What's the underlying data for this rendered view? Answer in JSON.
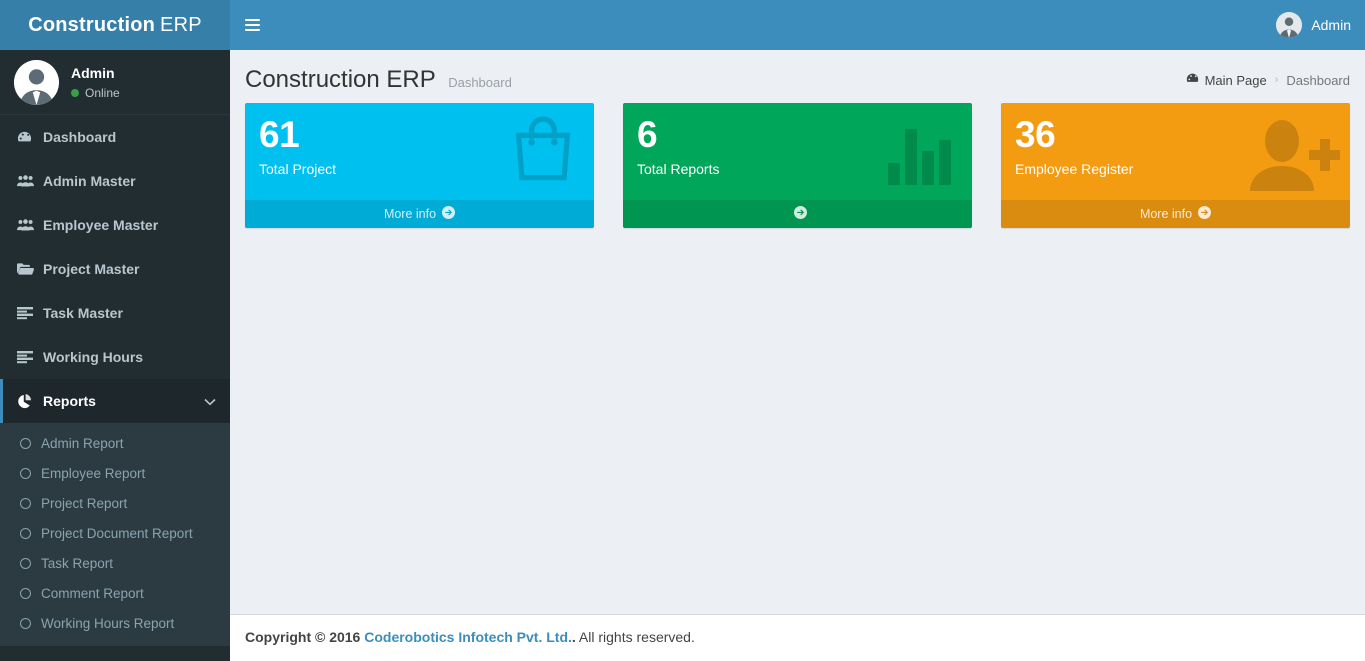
{
  "header": {
    "logo_bold": "Construction",
    "logo_light": "ERP",
    "toggle_icon": "hamburger-icon",
    "user_name": "Admin",
    "avatar_icon": "user-avatar-icon",
    "bg_color": "#3c8dbc",
    "logo_bg_color": "#367fa9"
  },
  "sidebar": {
    "bg_color": "#222d32",
    "user_panel": {
      "name": "Admin",
      "status": "Online",
      "status_color": "#3c9d46",
      "avatar_icon": "user-avatar-icon"
    },
    "items": [
      {
        "label": "Dashboard",
        "icon": "dashboard-icon",
        "active": false
      },
      {
        "label": "Admin Master",
        "icon": "users-icon",
        "active": false
      },
      {
        "label": "Employee Master",
        "icon": "users-icon",
        "active": false
      },
      {
        "label": "Project Master",
        "icon": "folder-open-icon",
        "active": false
      },
      {
        "label": "Task Master",
        "icon": "list-icon",
        "active": false
      },
      {
        "label": "Working Hours",
        "icon": "list-icon",
        "active": false
      },
      {
        "label": "Reports",
        "icon": "pie-chart-icon",
        "active": true,
        "chevron": "chevron-down-icon"
      }
    ],
    "submenu": {
      "bg_color": "#2c3b41",
      "items": [
        {
          "label": "Admin Report",
          "icon": "circle-o-icon"
        },
        {
          "label": "Employee Report",
          "icon": "circle-o-icon"
        },
        {
          "label": "Project Report",
          "icon": "circle-o-icon"
        },
        {
          "label": "Project Document Report",
          "icon": "circle-o-icon"
        },
        {
          "label": "Task Report",
          "icon": "circle-o-icon"
        },
        {
          "label": "Comment Report",
          "icon": "circle-o-icon"
        },
        {
          "label": "Working Hours Report",
          "icon": "circle-o-icon"
        }
      ]
    }
  },
  "content": {
    "title": "Construction ERP",
    "subtitle": "Dashboard",
    "breadcrumb": {
      "home_icon": "dashboard-icon",
      "home_label": "Main Page",
      "separator": "›",
      "current_label": "Dashboard"
    },
    "boxes": [
      {
        "number": "61",
        "label": "Total Project",
        "color": "#00c0ef",
        "footer_label": "More info",
        "footer_icon": "arrow-circle-right-icon",
        "icon": "shopping-bag-icon"
      },
      {
        "number": "6",
        "label": "Total Reports",
        "color": "#00a65a",
        "footer_label": "",
        "footer_icon": "arrow-circle-right-icon",
        "icon": "bar-chart-icon"
      },
      {
        "number": "36",
        "label": "Employee Register",
        "color": "#f39c12",
        "footer_label": "More info",
        "footer_icon": "arrow-circle-right-icon",
        "icon": "user-plus-icon"
      }
    ]
  },
  "footer": {
    "copyright_bold": "Copyright © 2016",
    "company_link": "Coderobotics Infotech Pvt. Ltd.",
    "rights_text": "All rights reserved."
  }
}
